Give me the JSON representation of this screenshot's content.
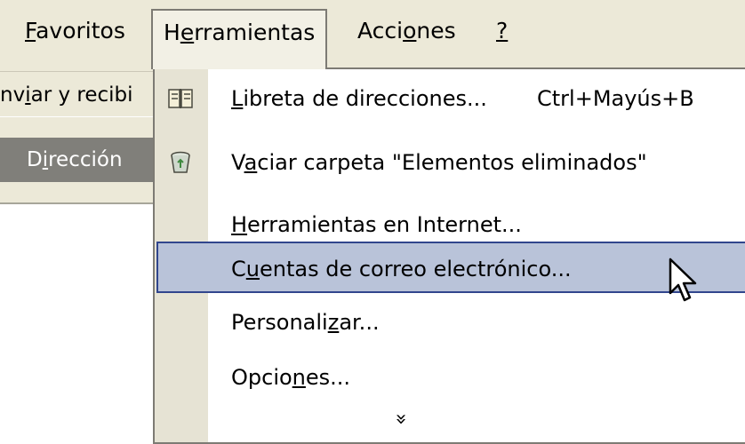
{
  "menubar": {
    "items": [
      {
        "pre": "",
        "ul": "F",
        "post": "avoritos"
      },
      {
        "pre": "H",
        "ul": "e",
        "post": "rramientas"
      },
      {
        "pre": "Acci",
        "ul": "o",
        "post": "nes"
      },
      {
        "pre": "",
        "ul": "?",
        "post": ""
      }
    ]
  },
  "toolbar": {
    "send": {
      "pre": "nv",
      "ul": "i",
      "post": "ar y recibi"
    }
  },
  "address": {
    "pre": "D",
    "ul": "i",
    "post": "rección"
  },
  "menu": {
    "items": [
      {
        "pre": "",
        "ul": "L",
        "post": "ibreta de direcciones...",
        "shortcut": "Ctrl+Mayús+B",
        "icon": "address-book-icon"
      },
      {
        "pre": "V",
        "ul": "a",
        "post": "ciar carpeta \"Elementos eliminados\"",
        "shortcut": "",
        "icon": "recycle-bin-icon"
      },
      {
        "pre": "",
        "ul": "H",
        "post": "erramientas en Internet...",
        "shortcut": "",
        "icon": ""
      },
      {
        "pre": "C",
        "ul": "u",
        "post": "entas de correo electrónico...",
        "shortcut": "",
        "icon": ""
      },
      {
        "pre": "Personali",
        "ul": "z",
        "post": "ar...",
        "shortcut": "",
        "icon": ""
      },
      {
        "pre": "Opcio",
        "ul": "n",
        "post": "es...",
        "shortcut": "",
        "icon": ""
      }
    ],
    "more": "»",
    "highlighted_index": 3
  },
  "colors": {
    "highlight": "#b9c3d9",
    "highlight_border": "#31468d",
    "menubar": "#ece9d8"
  }
}
